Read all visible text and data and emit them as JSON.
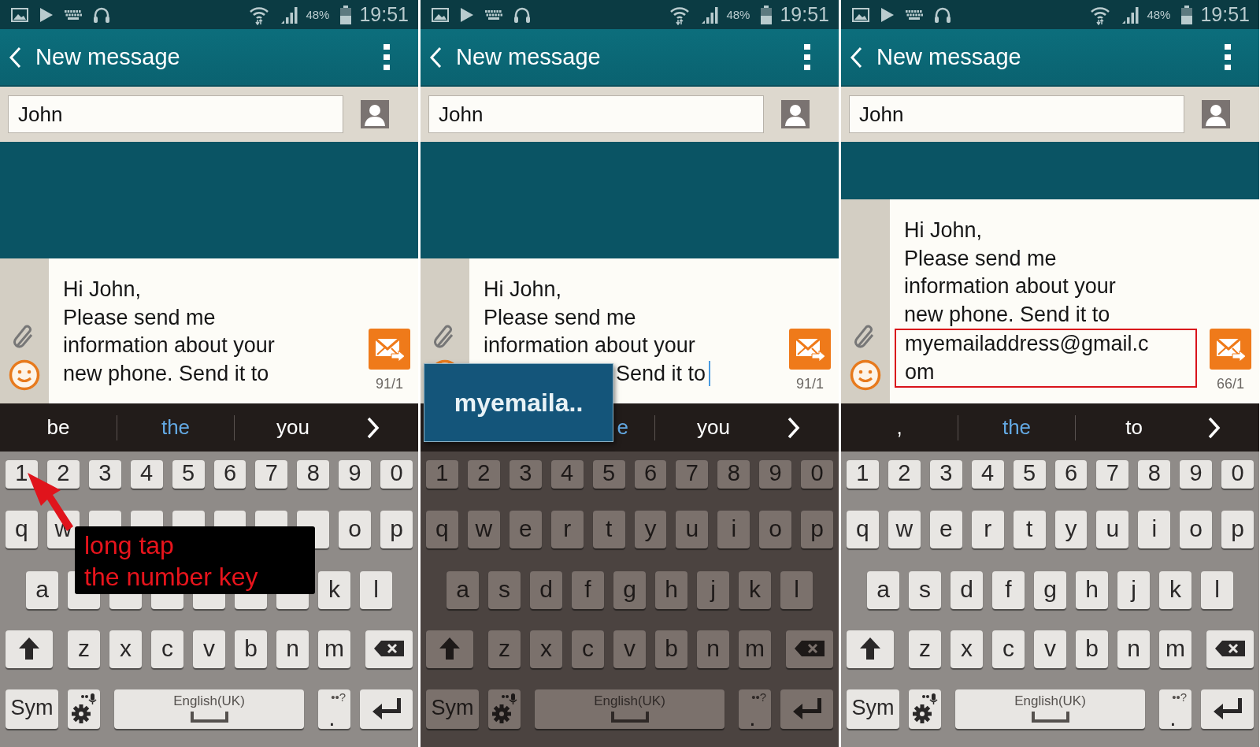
{
  "panels": [
    {
      "status": {
        "battery": "48%",
        "time": "19:51"
      },
      "title": "New message",
      "recipient": "John",
      "message": [
        "Hi John,",
        "Please send me",
        "information about your",
        "new phone. Send it to"
      ],
      "counter": "91/1",
      "suggestions": [
        {
          "label": "be",
          "selected": false
        },
        {
          "label": "the",
          "selected": true
        },
        {
          "label": "you",
          "selected": false
        }
      ],
      "keyboard": {
        "rows": [
          [
            "1",
            "2",
            "3",
            "4",
            "5",
            "6",
            "7",
            "8",
            "9",
            "0"
          ],
          [
            "q",
            "w",
            {
              "kind": "blank"
            },
            {
              "kind": "blank"
            },
            {
              "kind": "blank"
            },
            {
              "kind": "blank"
            },
            {
              "kind": "blank"
            },
            {
              "kind": "blank"
            },
            "o",
            "p"
          ],
          [
            "a",
            {
              "kind": "blank"
            },
            {
              "kind": "blank"
            },
            {
              "kind": "blank"
            },
            {
              "kind": "blank"
            },
            {
              "kind": "blank"
            },
            {
              "kind": "blank"
            },
            "k",
            "l"
          ],
          [
            "z",
            "x",
            "c",
            "v",
            "b",
            "n",
            "m"
          ]
        ],
        "sym": "Sym",
        "space": "English(UK)",
        "period": ".",
        "period_hint": "••?"
      },
      "annotation": {
        "lines": [
          "long tap",
          "the number key"
        ]
      }
    },
    {
      "status": {
        "battery": "48%",
        "time": "19:51"
      },
      "title": "New message",
      "recipient": "John",
      "message": [
        "Hi John,",
        "Please send me",
        "information about your",
        {
          "kind": "cut_left",
          "text": "Send it to"
        }
      ],
      "cursor": true,
      "counter": "91/1",
      "suggestions": [
        {
          "kind": "blank"
        },
        {
          "kind": "cut_left",
          "label": "e",
          "selected": true
        },
        {
          "label": "you",
          "selected": false
        }
      ],
      "keyboard": {
        "dimmed": true,
        "rows": [
          [
            "1",
            "2",
            "3",
            "4",
            "5",
            "6",
            "7",
            "8",
            "9",
            "0"
          ],
          [
            "q",
            "w",
            "e",
            "r",
            "t",
            "y",
            "u",
            "i",
            "o",
            "p"
          ],
          [
            "a",
            "s",
            "d",
            "f",
            "g",
            "h",
            "j",
            "k",
            "l"
          ],
          [
            "z",
            "x",
            "c",
            "v",
            "b",
            "n",
            "m"
          ]
        ],
        "sym": "Sym",
        "space": "English(UK)",
        "period": ".",
        "period_hint": "••?"
      },
      "popup": {
        "text": "myemaila.."
      }
    },
    {
      "status": {
        "battery": "48%",
        "time": "19:51"
      },
      "title": "New message",
      "recipient": "John",
      "message": [
        "Hi John,",
        "Please send me",
        "information about your",
        "new phone. Send it to"
      ],
      "counter": "66/1",
      "highlight": [
        "myemailaddress@gmail.c",
        "om"
      ],
      "suggestions": [
        {
          "label": ",",
          "selected": false
        },
        {
          "label": "the",
          "selected": true
        },
        {
          "label": "to",
          "selected": false
        }
      ],
      "keyboard": {
        "rows": [
          [
            "1",
            "2",
            "3",
            "4",
            "5",
            "6",
            "7",
            "8",
            "9",
            "0"
          ],
          [
            "q",
            "w",
            "e",
            "r",
            "t",
            "y",
            "u",
            "i",
            "o",
            "p"
          ],
          [
            "a",
            "s",
            "d",
            "f",
            "g",
            "h",
            "j",
            "k",
            "l"
          ],
          [
            "z",
            "x",
            "c",
            "v",
            "b",
            "n",
            "m"
          ]
        ],
        "sym": "Sym",
        "space": "English(UK)",
        "period": ".",
        "period_hint": "••?"
      }
    }
  ]
}
